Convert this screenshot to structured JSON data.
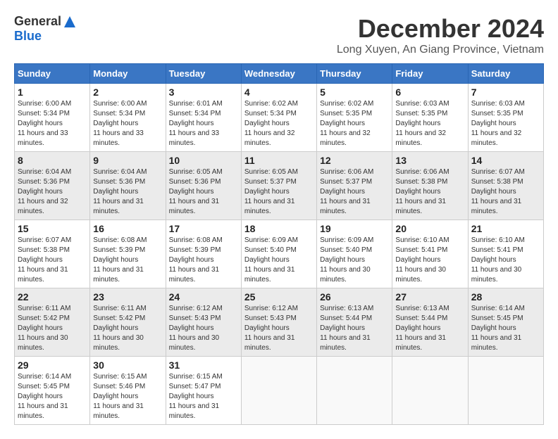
{
  "logo": {
    "general": "General",
    "blue": "Blue"
  },
  "title": {
    "month": "December 2024",
    "location": "Long Xuyen, An Giang Province, Vietnam"
  },
  "weekdays": [
    "Sunday",
    "Monday",
    "Tuesday",
    "Wednesday",
    "Thursday",
    "Friday",
    "Saturday"
  ],
  "weeks": [
    [
      {
        "day": "1",
        "sunrise": "6:00 AM",
        "sunset": "5:34 PM",
        "daylight": "11 hours and 33 minutes."
      },
      {
        "day": "2",
        "sunrise": "6:00 AM",
        "sunset": "5:34 PM",
        "daylight": "11 hours and 33 minutes."
      },
      {
        "day": "3",
        "sunrise": "6:01 AM",
        "sunset": "5:34 PM",
        "daylight": "11 hours and 33 minutes."
      },
      {
        "day": "4",
        "sunrise": "6:02 AM",
        "sunset": "5:34 PM",
        "daylight": "11 hours and 32 minutes."
      },
      {
        "day": "5",
        "sunrise": "6:02 AM",
        "sunset": "5:35 PM",
        "daylight": "11 hours and 32 minutes."
      },
      {
        "day": "6",
        "sunrise": "6:03 AM",
        "sunset": "5:35 PM",
        "daylight": "11 hours and 32 minutes."
      },
      {
        "day": "7",
        "sunrise": "6:03 AM",
        "sunset": "5:35 PM",
        "daylight": "11 hours and 32 minutes."
      }
    ],
    [
      {
        "day": "8",
        "sunrise": "6:04 AM",
        "sunset": "5:36 PM",
        "daylight": "11 hours and 32 minutes."
      },
      {
        "day": "9",
        "sunrise": "6:04 AM",
        "sunset": "5:36 PM",
        "daylight": "11 hours and 31 minutes."
      },
      {
        "day": "10",
        "sunrise": "6:05 AM",
        "sunset": "5:36 PM",
        "daylight": "11 hours and 31 minutes."
      },
      {
        "day": "11",
        "sunrise": "6:05 AM",
        "sunset": "5:37 PM",
        "daylight": "11 hours and 31 minutes."
      },
      {
        "day": "12",
        "sunrise": "6:06 AM",
        "sunset": "5:37 PM",
        "daylight": "11 hours and 31 minutes."
      },
      {
        "day": "13",
        "sunrise": "6:06 AM",
        "sunset": "5:38 PM",
        "daylight": "11 hours and 31 minutes."
      },
      {
        "day": "14",
        "sunrise": "6:07 AM",
        "sunset": "5:38 PM",
        "daylight": "11 hours and 31 minutes."
      }
    ],
    [
      {
        "day": "15",
        "sunrise": "6:07 AM",
        "sunset": "5:38 PM",
        "daylight": "11 hours and 31 minutes."
      },
      {
        "day": "16",
        "sunrise": "6:08 AM",
        "sunset": "5:39 PM",
        "daylight": "11 hours and 31 minutes."
      },
      {
        "day": "17",
        "sunrise": "6:08 AM",
        "sunset": "5:39 PM",
        "daylight": "11 hours and 31 minutes."
      },
      {
        "day": "18",
        "sunrise": "6:09 AM",
        "sunset": "5:40 PM",
        "daylight": "11 hours and 31 minutes."
      },
      {
        "day": "19",
        "sunrise": "6:09 AM",
        "sunset": "5:40 PM",
        "daylight": "11 hours and 30 minutes."
      },
      {
        "day": "20",
        "sunrise": "6:10 AM",
        "sunset": "5:41 PM",
        "daylight": "11 hours and 30 minutes."
      },
      {
        "day": "21",
        "sunrise": "6:10 AM",
        "sunset": "5:41 PM",
        "daylight": "11 hours and 30 minutes."
      }
    ],
    [
      {
        "day": "22",
        "sunrise": "6:11 AM",
        "sunset": "5:42 PM",
        "daylight": "11 hours and 30 minutes."
      },
      {
        "day": "23",
        "sunrise": "6:11 AM",
        "sunset": "5:42 PM",
        "daylight": "11 hours and 30 minutes."
      },
      {
        "day": "24",
        "sunrise": "6:12 AM",
        "sunset": "5:43 PM",
        "daylight": "11 hours and 30 minutes."
      },
      {
        "day": "25",
        "sunrise": "6:12 AM",
        "sunset": "5:43 PM",
        "daylight": "11 hours and 31 minutes."
      },
      {
        "day": "26",
        "sunrise": "6:13 AM",
        "sunset": "5:44 PM",
        "daylight": "11 hours and 31 minutes."
      },
      {
        "day": "27",
        "sunrise": "6:13 AM",
        "sunset": "5:44 PM",
        "daylight": "11 hours and 31 minutes."
      },
      {
        "day": "28",
        "sunrise": "6:14 AM",
        "sunset": "5:45 PM",
        "daylight": "11 hours and 31 minutes."
      }
    ],
    [
      {
        "day": "29",
        "sunrise": "6:14 AM",
        "sunset": "5:45 PM",
        "daylight": "11 hours and 31 minutes."
      },
      {
        "day": "30",
        "sunrise": "6:15 AM",
        "sunset": "5:46 PM",
        "daylight": "11 hours and 31 minutes."
      },
      {
        "day": "31",
        "sunrise": "6:15 AM",
        "sunset": "5:47 PM",
        "daylight": "11 hours and 31 minutes."
      },
      null,
      null,
      null,
      null
    ]
  ]
}
